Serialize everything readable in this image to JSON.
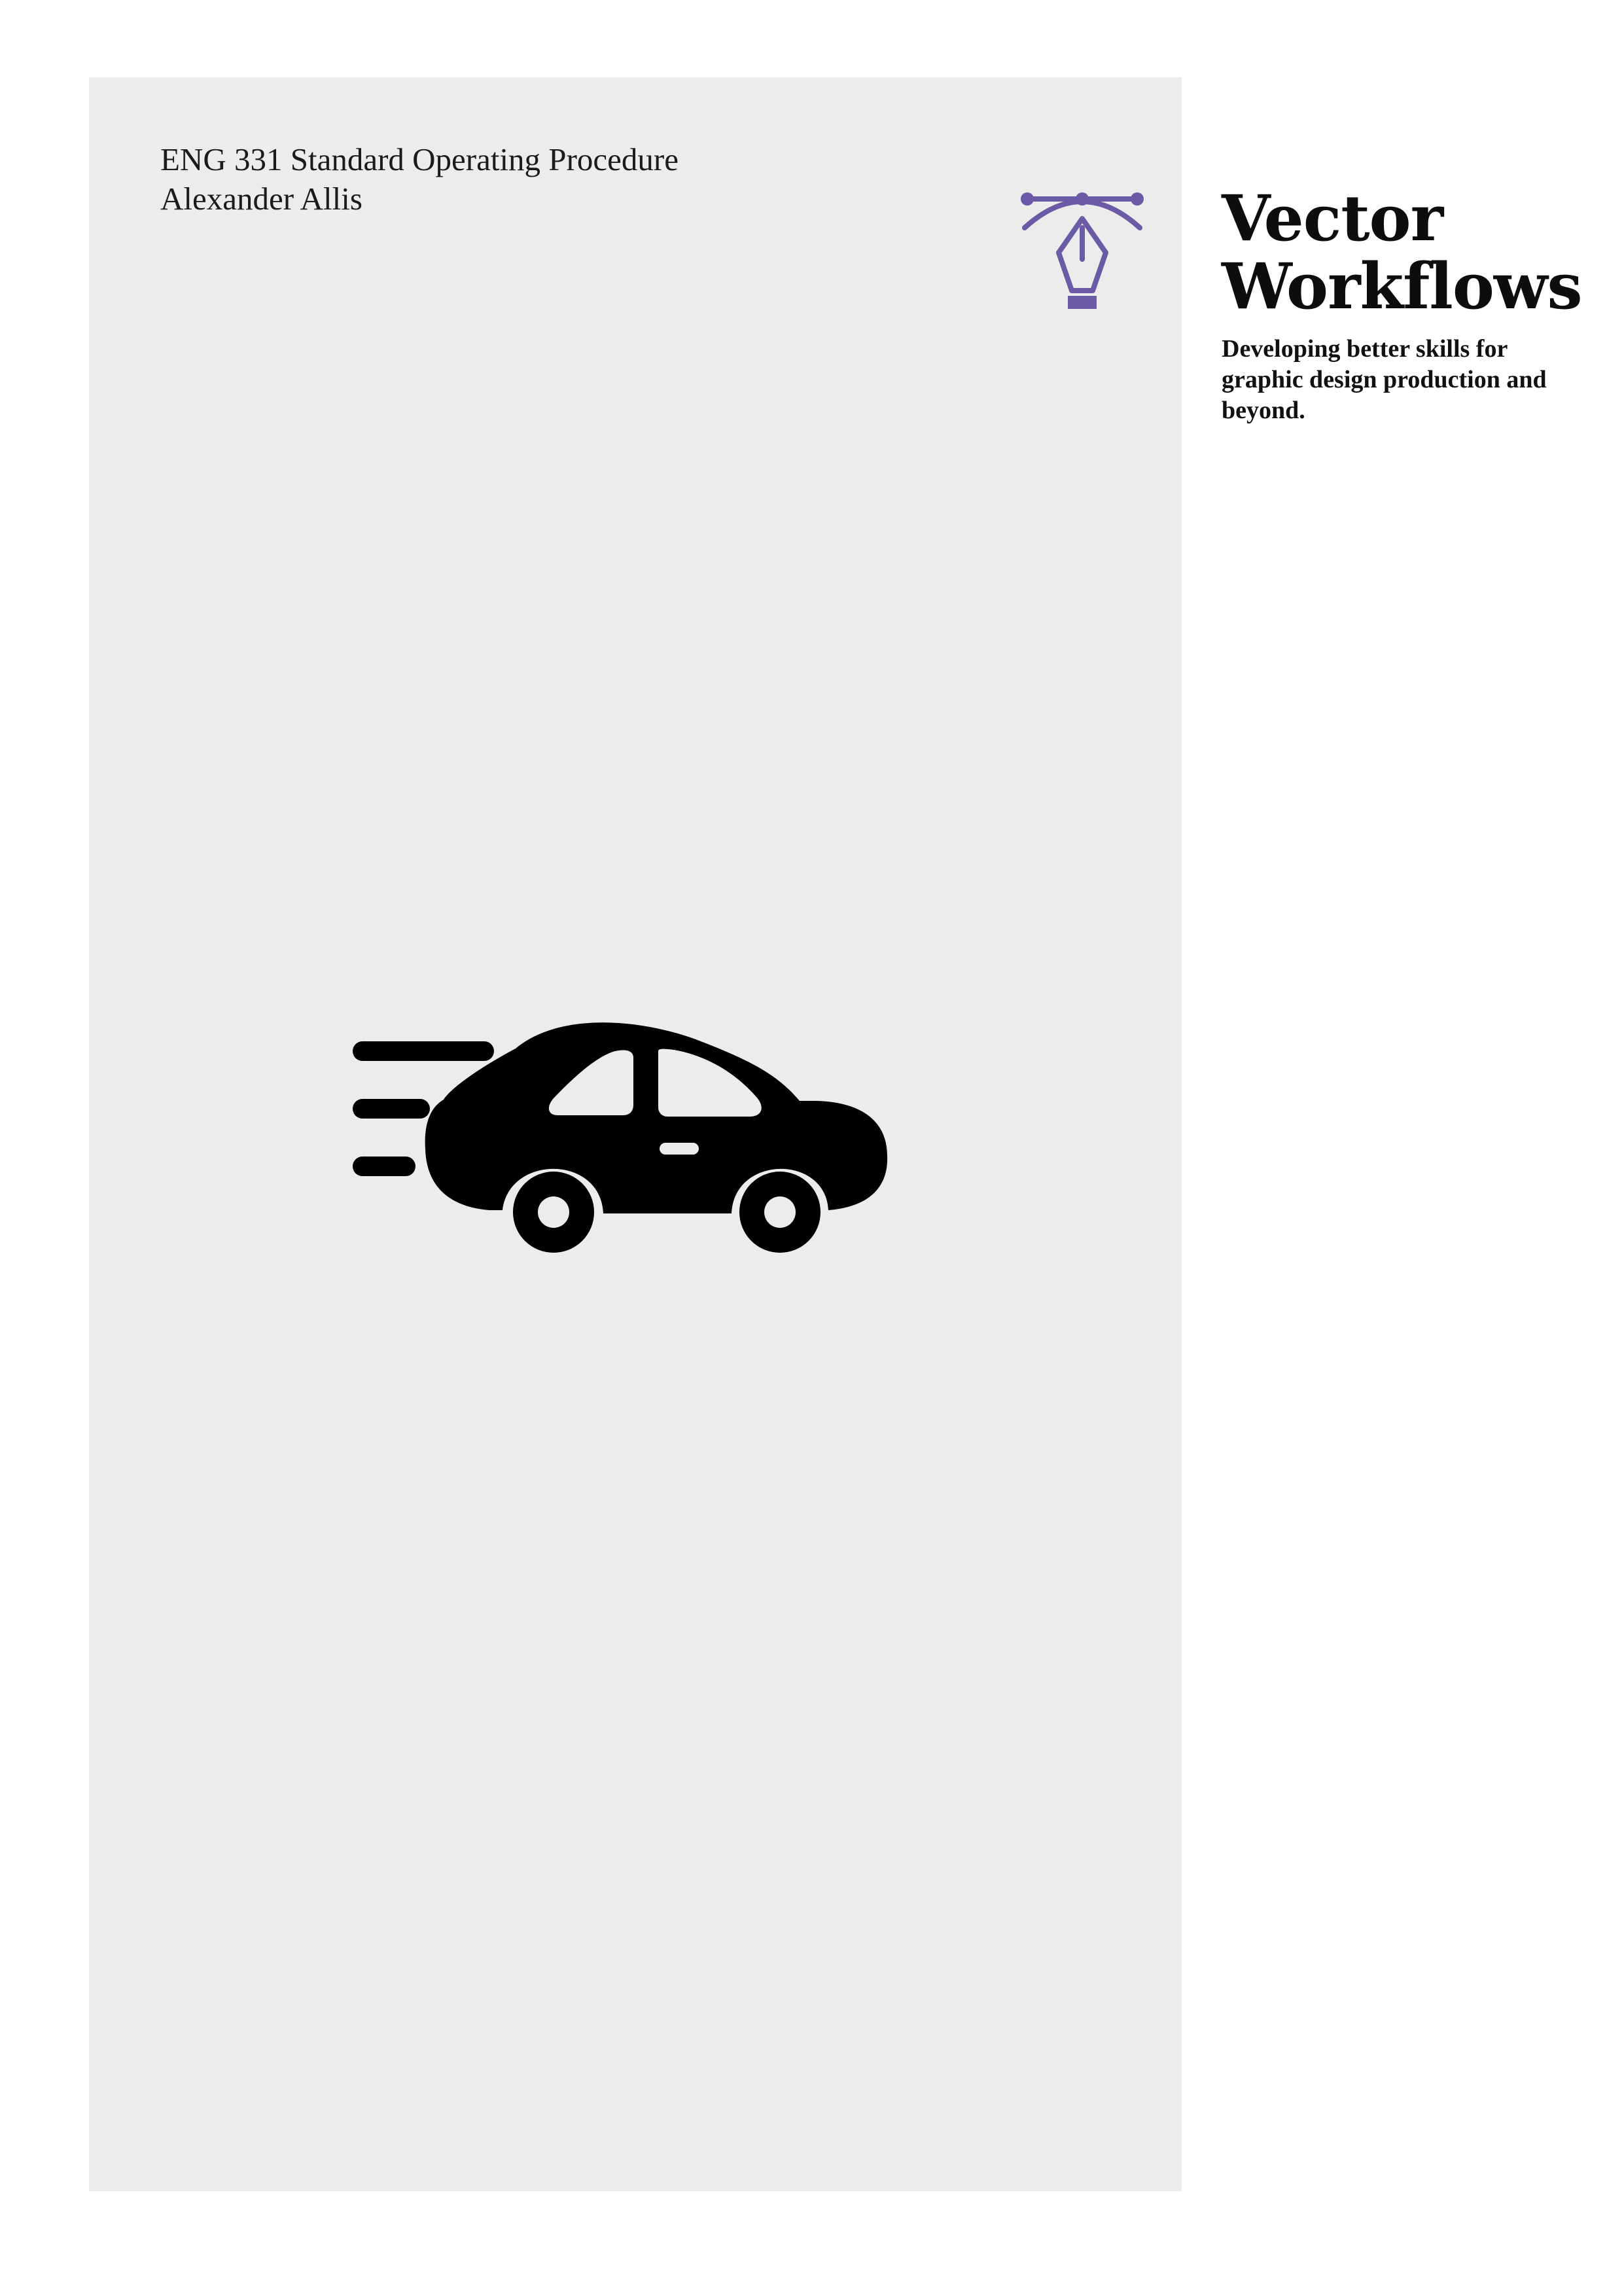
{
  "cover": {
    "course_title": "ENG 331 Standard Operating Procedure",
    "author": "Alexander Allis"
  },
  "brand": {
    "title_line1": "Vector",
    "title_line2": "Workflows",
    "tagline": "Developing better skills for graphic design production and beyond.",
    "logo_icon": "pen-tool-icon",
    "accent_color": "#6b5aa6"
  },
  "illustration": {
    "icon": "speeding-car-icon",
    "color": "#000000"
  },
  "colors": {
    "panel_background": "#ececec",
    "page_background": "#ffffff"
  }
}
